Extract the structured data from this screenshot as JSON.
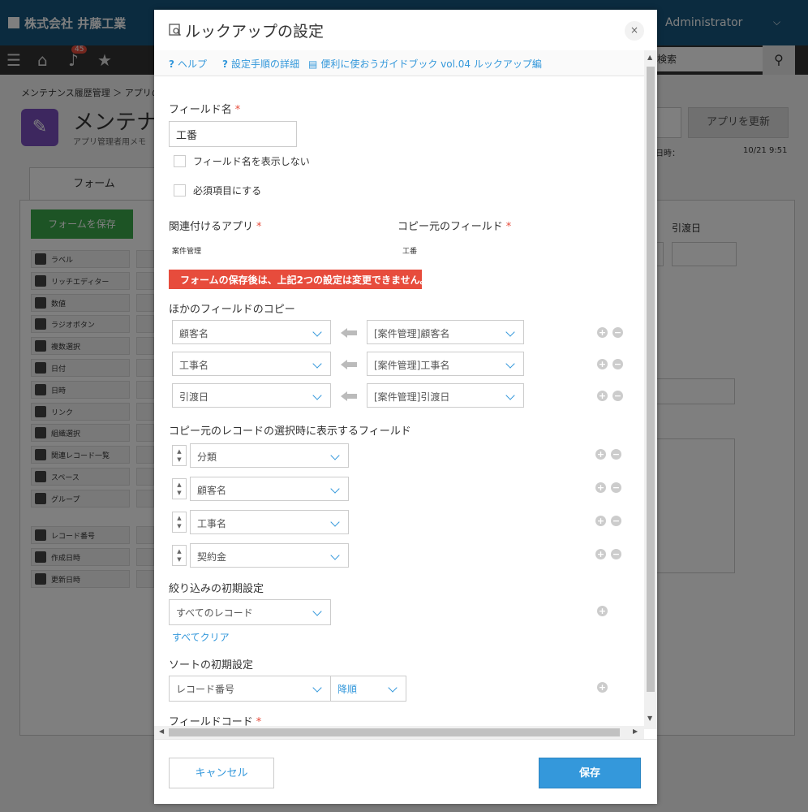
{
  "background": {
    "company": "株式会社 井藤工業",
    "user": "Administrator",
    "notif_count": "45",
    "search_placeholder": "検索",
    "breadcrumb": "メンテナンス履歴管理 ＞ アプリの",
    "app_title": "メンテナン",
    "app_memo": "アプリ管理者用メモ",
    "update_button": "アプリを更新",
    "updated_label": "日時：",
    "updated_time": "10/21 9:51",
    "tab_form": "フォーム",
    "save_form": "フォームを保存",
    "right_label": "引渡日",
    "palette": [
      "ラベル",
      "リッチエディター",
      "数値",
      "ラジオボタン",
      "複数選択",
      "日付",
      "日時",
      "リンク",
      "組織選択",
      "関連レコード一覧",
      "スペース",
      "グループ",
      "レコード番号",
      "作成日時",
      "更新日時"
    ]
  },
  "dialog": {
    "title": "ルックアップの設定",
    "close": "×",
    "links": {
      "help": "ヘルプ",
      "setup": "設定手順の詳細",
      "guide": "便利に使おうガイドブック vol.04 ルックアップ編"
    },
    "field_name_label": "フィールド名",
    "field_name_value": "工番",
    "hide_name_label": "フィールド名を表示しない",
    "required_label": "必須項目にする",
    "related_app_label": "関連付けるアプリ",
    "related_app_value": "案件管理",
    "source_field_label": "コピー元のフィールド",
    "source_field_value": "工番",
    "warning": "フォームの保存後は、上記2つの設定は変更できません。",
    "copy_section_label": "ほかのフィールドのコピー",
    "copy_rows": [
      {
        "dest": "顧客名",
        "src": "[案件管理]顧客名"
      },
      {
        "dest": "工事名",
        "src": "[案件管理]工事名"
      },
      {
        "dest": "引渡日",
        "src": "[案件管理]引渡日"
      }
    ],
    "display_section_label": "コピー元のレコードの選択時に表示するフィールド",
    "display_fields": [
      "分類",
      "顧客名",
      "工事名",
      "契約金"
    ],
    "filter_label": "絞り込みの初期設定",
    "filter_value": "すべてのレコード",
    "clear_all": "すべてクリア",
    "sort_label": "ソートの初期設定",
    "sort_field": "レコード番号",
    "sort_order": "降順",
    "field_code_label": "フィールドコード",
    "cancel": "キャンセル",
    "save": "保存"
  }
}
